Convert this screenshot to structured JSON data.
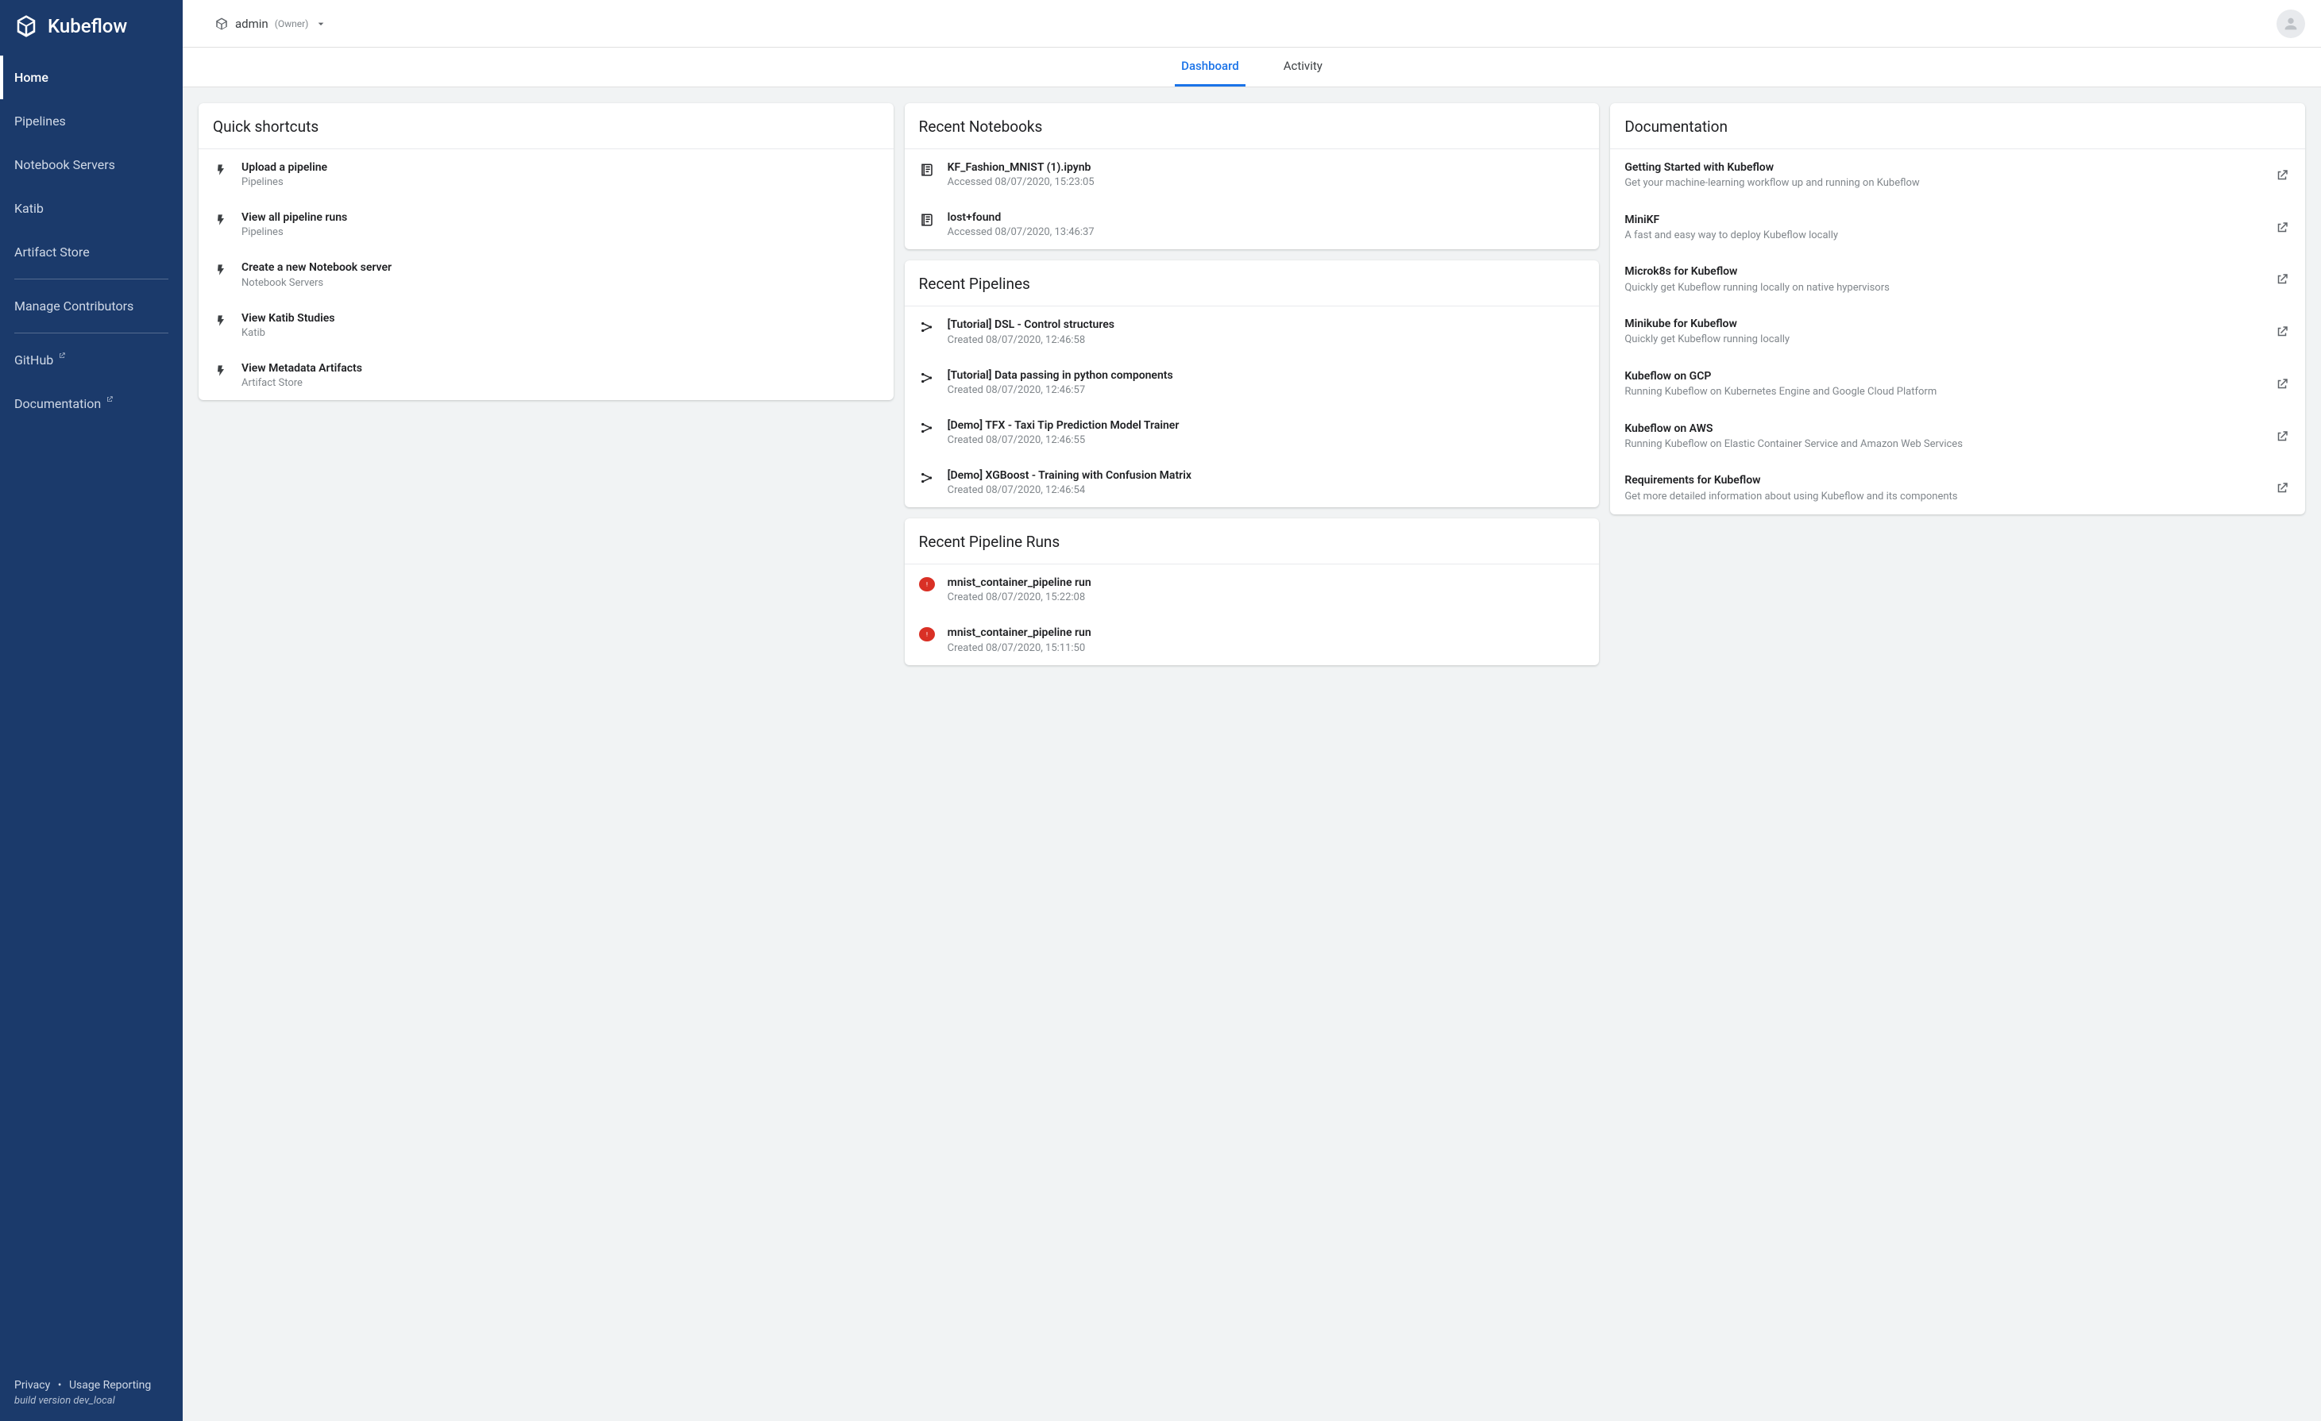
{
  "brand": {
    "name": "Kubeflow"
  },
  "sidebar": {
    "items": [
      {
        "label": "Home",
        "active": true
      },
      {
        "label": "Pipelines"
      },
      {
        "label": "Notebook Servers"
      },
      {
        "label": "Katib"
      },
      {
        "label": "Artifact Store"
      }
    ],
    "secondary": [
      {
        "label": "Manage Contributors"
      }
    ],
    "external": [
      {
        "label": "GitHub"
      },
      {
        "label": "Documentation"
      }
    ],
    "footer": {
      "privacy": "Privacy",
      "usage": "Usage Reporting",
      "build": "build version dev_local"
    }
  },
  "topbar": {
    "namespace": "admin",
    "role": "(Owner)"
  },
  "tabs": [
    {
      "label": "Dashboard",
      "active": true
    },
    {
      "label": "Activity"
    }
  ],
  "cards": {
    "shortcuts": {
      "title": "Quick shortcuts",
      "items": [
        {
          "title": "Upload a pipeline",
          "sub": "Pipelines"
        },
        {
          "title": "View all pipeline runs",
          "sub": "Pipelines"
        },
        {
          "title": "Create a new Notebook server",
          "sub": "Notebook Servers"
        },
        {
          "title": "View Katib Studies",
          "sub": "Katib"
        },
        {
          "title": "View Metadata Artifacts",
          "sub": "Artifact Store"
        }
      ]
    },
    "notebooks": {
      "title": "Recent Notebooks",
      "items": [
        {
          "title": "KF_Fashion_MNIST (1).ipynb",
          "sub": "Accessed 08/07/2020, 15:23:05"
        },
        {
          "title": "lost+found",
          "sub": "Accessed 08/07/2020, 13:46:37"
        }
      ]
    },
    "pipelines": {
      "title": "Recent Pipelines",
      "items": [
        {
          "title": "[Tutorial] DSL - Control structures",
          "sub": "Created 08/07/2020, 12:46:58"
        },
        {
          "title": "[Tutorial] Data passing in python components",
          "sub": "Created 08/07/2020, 12:46:57"
        },
        {
          "title": "[Demo] TFX - Taxi Tip Prediction Model Trainer",
          "sub": "Created 08/07/2020, 12:46:55"
        },
        {
          "title": "[Demo] XGBoost - Training with Confusion Matrix",
          "sub": "Created 08/07/2020, 12:46:54"
        }
      ]
    },
    "runs": {
      "title": "Recent Pipeline Runs",
      "items": [
        {
          "title": "mnist_container_pipeline run",
          "sub": "Created 08/07/2020, 15:22:08",
          "status": "error"
        },
        {
          "title": "mnist_container_pipeline run",
          "sub": "Created 08/07/2020, 15:11:50",
          "status": "error"
        }
      ]
    },
    "docs": {
      "title": "Documentation",
      "items": [
        {
          "title": "Getting Started with Kubeflow",
          "sub": "Get your machine-learning workflow up and running on Kubeflow"
        },
        {
          "title": "MiniKF",
          "sub": "A fast and easy way to deploy Kubeflow locally"
        },
        {
          "title": "Microk8s for Kubeflow",
          "sub": "Quickly get Kubeflow running locally on native hypervisors"
        },
        {
          "title": "Minikube for Kubeflow",
          "sub": "Quickly get Kubeflow running locally"
        },
        {
          "title": "Kubeflow on GCP",
          "sub": "Running Kubeflow on Kubernetes Engine and Google Cloud Platform"
        },
        {
          "title": "Kubeflow on AWS",
          "sub": "Running Kubeflow on Elastic Container Service and Amazon Web Services"
        },
        {
          "title": "Requirements for Kubeflow",
          "sub": "Get more detailed information about using Kubeflow and its components"
        }
      ]
    }
  }
}
